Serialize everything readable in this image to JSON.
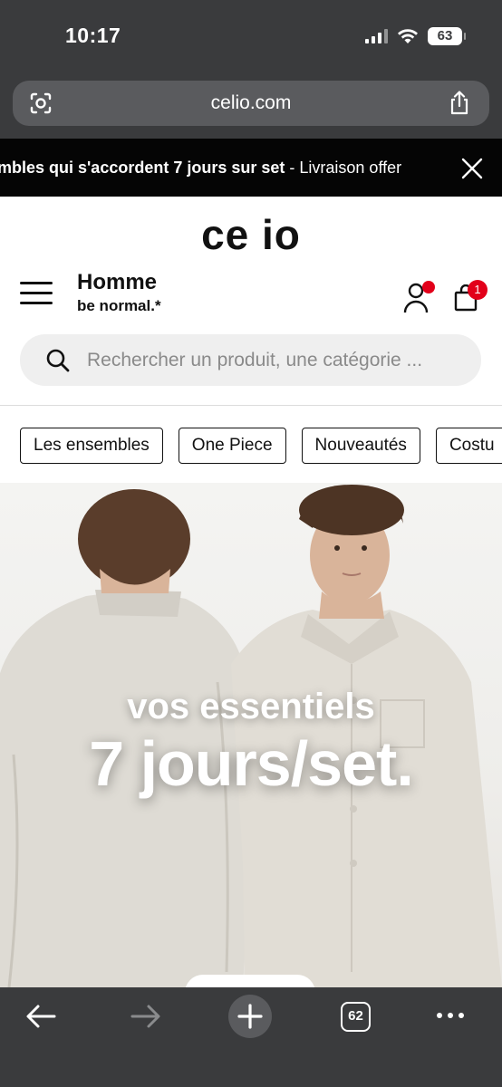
{
  "status_bar": {
    "time": "10:17",
    "battery": "63"
  },
  "browser": {
    "url": "celio.com"
  },
  "promo": {
    "bold_text": "mbles qui s'accordent 7 jours sur set",
    "separator": " - ",
    "normal_text": "Livraison offer"
  },
  "header": {
    "logo": "ce io",
    "gender_title": "Homme",
    "gender_tagline": "be normal.*",
    "cart_count": "1"
  },
  "search": {
    "placeholder": "Rechercher un produit, une catégorie ..."
  },
  "categories": [
    {
      "label": "Les ensembles"
    },
    {
      "label": "One Piece"
    },
    {
      "label": "Nouveautés"
    },
    {
      "label": "Costu"
    }
  ],
  "hero": {
    "line1": "vos essentiels",
    "line2": "7 jours/set."
  },
  "toolbar": {
    "tab_count": "62"
  },
  "colors": {
    "accent_red": "#e2001a",
    "chrome_dark": "#3a3b3d",
    "promo_bg": "#050505"
  },
  "icons": [
    "camera-search-icon",
    "share-icon",
    "close-icon",
    "menu-icon",
    "account-icon",
    "bag-icon",
    "search-icon",
    "back-arrow-icon",
    "forward-arrow-icon",
    "plus-icon",
    "tabs-icon",
    "more-icon"
  ]
}
